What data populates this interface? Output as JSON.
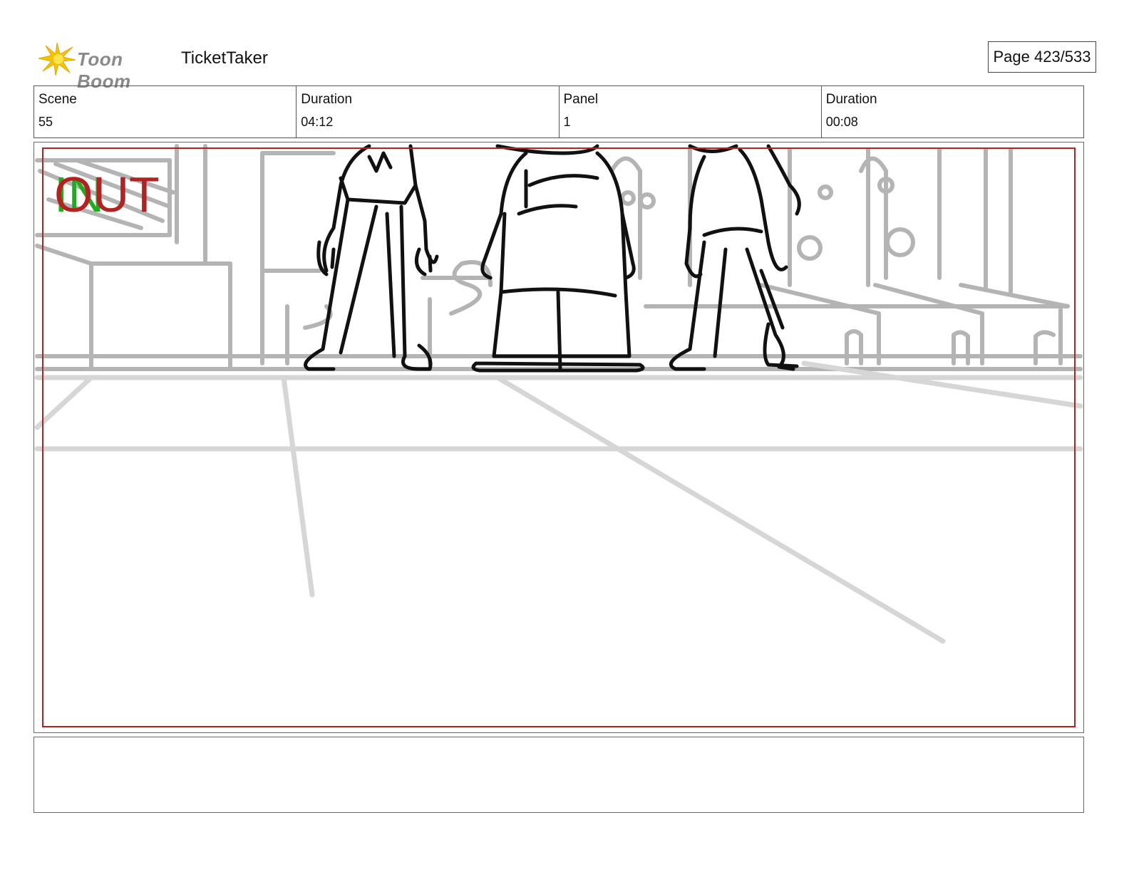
{
  "header": {
    "brand": "Toon Boom",
    "project_title": "TicketTaker",
    "page_indicator": "Page 423/533"
  },
  "info": {
    "scene_label": "Scene",
    "scene_value": "55",
    "scene_duration_label": "Duration",
    "scene_duration_value": "04:12",
    "panel_label": "Panel",
    "panel_value": "1",
    "panel_duration_label": "Duration",
    "panel_duration_value": "00:08"
  },
  "panel": {
    "in_marker": "IN",
    "out_marker": "OUT",
    "safe_frame_color": "#b22222",
    "in_color": "#22aa22",
    "out_color": "#b22222"
  },
  "notes": {
    "text": ""
  }
}
